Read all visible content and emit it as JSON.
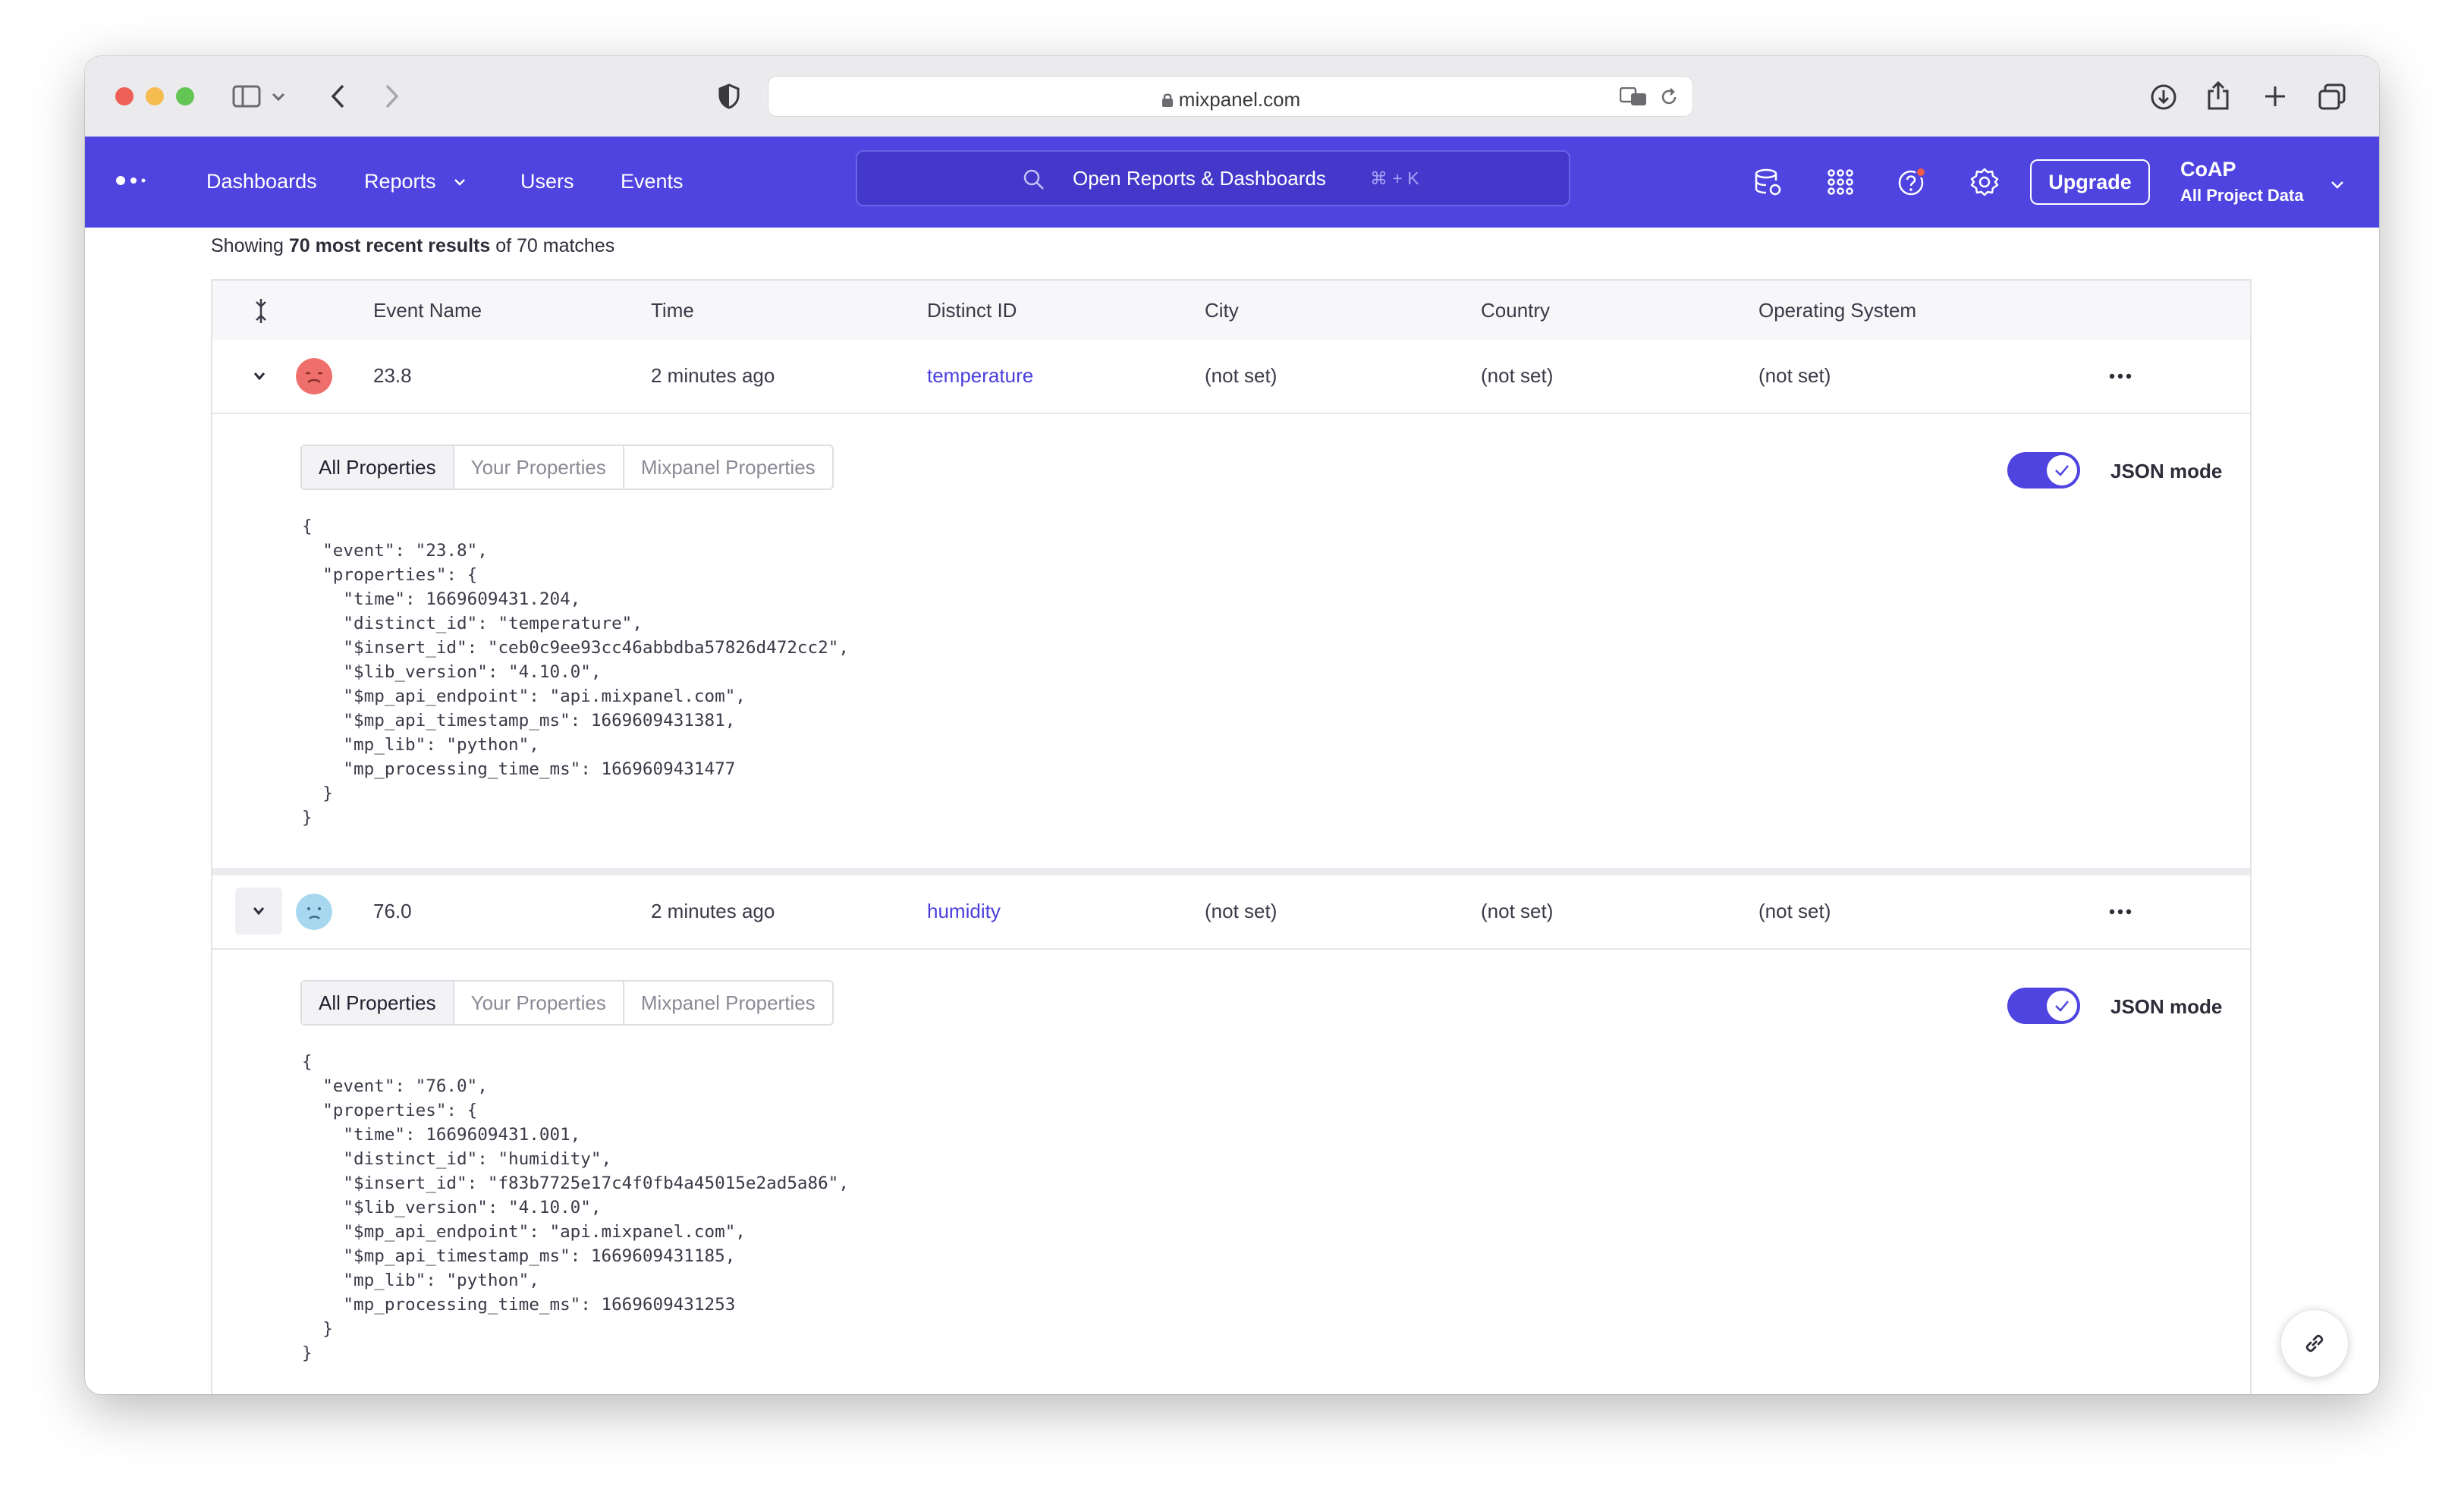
{
  "browser": {
    "url": "mixpanel.com"
  },
  "nav": {
    "links": [
      "Dashboards",
      "Reports",
      "Users",
      "Events"
    ],
    "search_label": "Open Reports & Dashboards",
    "search_shortcut": "⌘ + K",
    "upgrade_label": "Upgrade",
    "project_name": "CoAP",
    "project_scope": "All Project Data"
  },
  "results": {
    "prefix": "Showing ",
    "bold": "70 most recent results",
    "suffix": " of 70 matches"
  },
  "table": {
    "columns": [
      "Event Name",
      "Time",
      "Distinct ID",
      "City",
      "Country",
      "Operating System"
    ],
    "rows": [
      {
        "event_name": "23.8",
        "time": "2 minutes ago",
        "distinct_id": "temperature",
        "city": "(not set)",
        "country": "(not set)",
        "os": "(not set)",
        "avatar_color": "#ef6f6c",
        "json": "{\n  \"event\": \"23.8\",\n  \"properties\": {\n    \"time\": 1669609431.204,\n    \"distinct_id\": \"temperature\",\n    \"$insert_id\": \"ceb0c9ee93cc46abbdba57826d472cc2\",\n    \"$lib_version\": \"4.10.0\",\n    \"$mp_api_endpoint\": \"api.mixpanel.com\",\n    \"$mp_api_timestamp_ms\": 1669609431381,\n    \"mp_lib\": \"python\",\n    \"mp_processing_time_ms\": 1669609431477\n  }\n}"
      },
      {
        "event_name": "76.0",
        "time": "2 minutes ago",
        "distinct_id": "humidity",
        "city": "(not set)",
        "country": "(not set)",
        "os": "(not set)",
        "avatar_color": "#a8d8f0",
        "json": "{\n  \"event\": \"76.0\",\n  \"properties\": {\n    \"time\": 1669609431.001,\n    \"distinct_id\": \"humidity\",\n    \"$insert_id\": \"f83b7725e17c4f0fb4a45015e2ad5a86\",\n    \"$lib_version\": \"4.10.0\",\n    \"$mp_api_endpoint\": \"api.mixpanel.com\",\n    \"$mp_api_timestamp_ms\": 1669609431185,\n    \"mp_lib\": \"python\",\n    \"mp_processing_time_ms\": 1669609431253\n  }\n}"
      }
    ]
  },
  "property_tabs": [
    "All Properties",
    "Your Properties",
    "Mixpanel Properties"
  ],
  "json_mode_label": "JSON mode",
  "colors": {
    "brand": "#4f44e0",
    "link": "#4a3fdb"
  }
}
